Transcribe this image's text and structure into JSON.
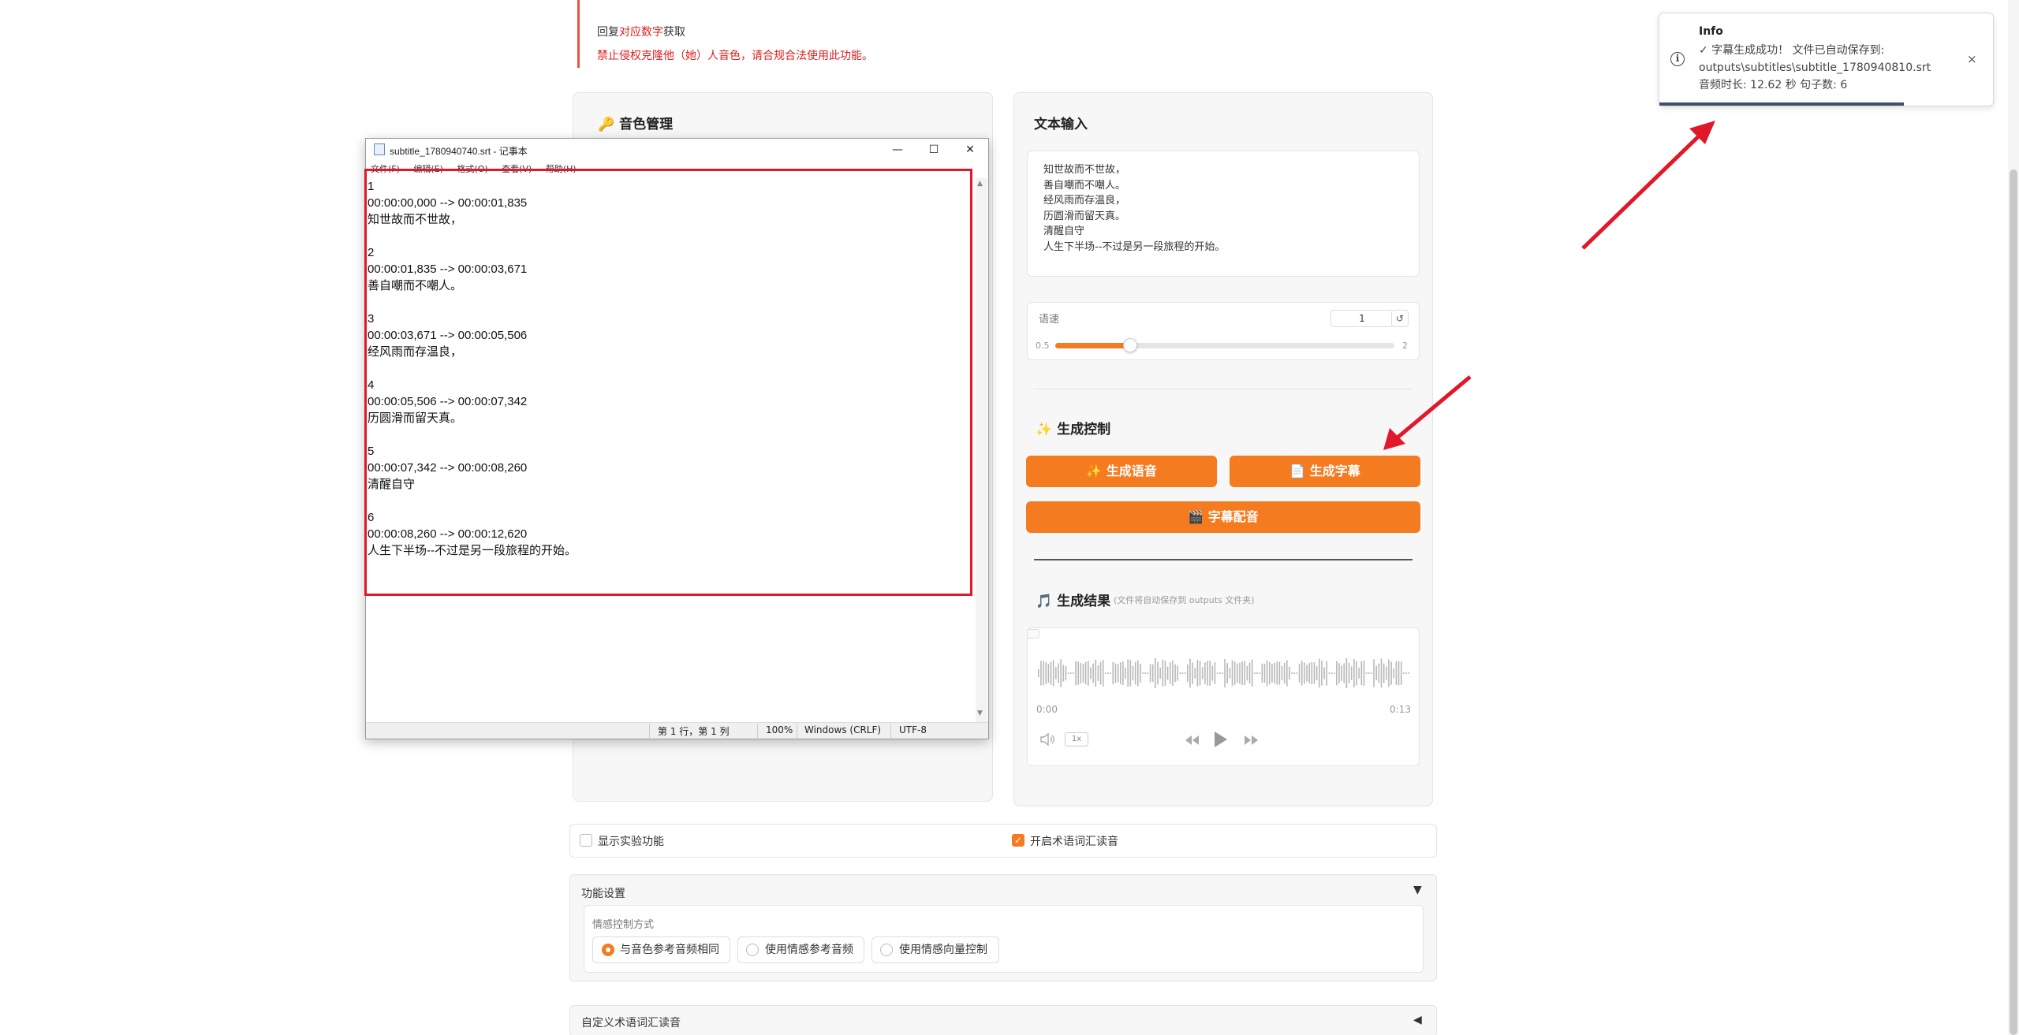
{
  "notice": {
    "line1": "回复对应数字获取",
    "line1_pre": "回复",
    "line1_red": "对应数字",
    "line1_post": "获取",
    "warning": "禁止侵权克隆他（她）人音色，请合规合法使用此功能。"
  },
  "voice_panel": {
    "title": "音色管理"
  },
  "text_panel": {
    "title": "文本输入",
    "text": "知世故而不世故，\n善自嘲而不嘲人。\n经风雨而存温良，\n历圆滑而留天真。\n清醒自守\n人生下半场--不过是另一段旅程的开始。",
    "speed_label": "语速",
    "speed_value": "1",
    "speed_min": "0.5",
    "speed_max": "2",
    "speed_fraction": 0.22
  },
  "generation": {
    "title": "生成控制",
    "btn_voice": "生成语音",
    "btn_subtitle": "生成字幕",
    "btn_dub": "字幕配音"
  },
  "result": {
    "title": "生成结果",
    "note": "(文件将自动保存到 outputs 文件夹)",
    "time_start": "0:00",
    "time_end": "0:13",
    "playback_speed": "1x"
  },
  "checkboxes": {
    "experimental": "显示实验功能",
    "term_reading": "开启术语词汇读音",
    "term_reading_checked": true
  },
  "settings": {
    "title": "功能设置",
    "emotion_label": "情感控制方式",
    "options": [
      "与音色参考音频相同",
      "使用情感参考音频",
      "使用情感向量控制"
    ],
    "selected": 0
  },
  "custom": {
    "title": "自定义术语词汇读音"
  },
  "notepad": {
    "title": "subtitle_1780940740.srt - 记事本",
    "menu": "文件(F) 编辑(E) 格式(O) 查看(V) 帮助(H)",
    "content": "1\n00:00:00,000 --> 00:00:01,835\n知世故而不世故，\n\n2\n00:00:01,835 --> 00:00:03,671\n善自嘲而不嘲人。\n\n3\n00:00:03,671 --> 00:00:05,506\n经风雨而存温良，\n\n4\n00:00:05,506 --> 00:00:07,342\n历圆滑而留天真。\n\n5\n00:00:07,342 --> 00:00:08,260\n清醒自守\n\n6\n00:00:08,260 --> 00:00:12,620\n人生下半场--不过是另一段旅程的开始。",
    "status_pos": "第 1 行，第 1 列",
    "status_zoom": "100%",
    "status_eol": "Windows (CRLF)",
    "status_enc": "UTF-8"
  },
  "toast": {
    "title": "Info",
    "message": "✓ 字幕生成成功！ 文件已自动保存到: outputs\\subtitles\\subtitle_1780940810.srt 音频时长: 12.62 秒 句子数: 6",
    "close": "×"
  },
  "colors": {
    "accent": "#f47b20",
    "annotation_red": "#e0182a",
    "warning_red": "#e02020"
  }
}
